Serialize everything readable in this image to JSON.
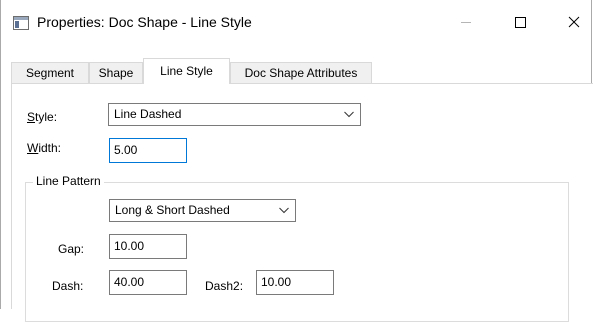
{
  "window": {
    "title": "Properties: Doc Shape - Line Style"
  },
  "tabs": [
    {
      "label": "Segment"
    },
    {
      "label": "Shape"
    },
    {
      "label": "Line Style"
    },
    {
      "label": "Doc Shape Attributes"
    }
  ],
  "active_tab": "Line Style",
  "style": {
    "label_mnemonic": "S",
    "label_rest": "tyle:",
    "value": "Line Dashed"
  },
  "width": {
    "label_mnemonic": "W",
    "label_rest": "idth:",
    "value": "5.00"
  },
  "line_pattern": {
    "group_title": "Line Pattern",
    "pattern_value": "Long & Short Dashed",
    "gap_label": "Gap:",
    "gap_value": "10.00",
    "dash_label": "Dash:",
    "dash_value": "40.00",
    "dash2_label": "Dash2:",
    "dash2_value": "10.00"
  }
}
